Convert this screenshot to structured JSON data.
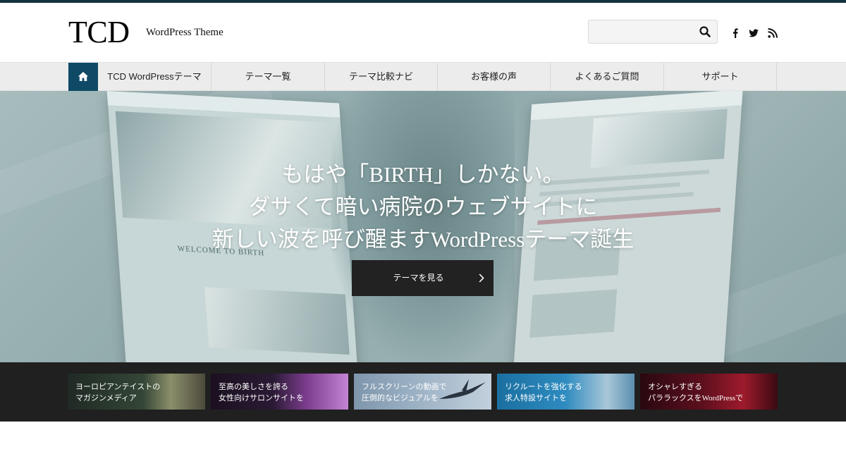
{
  "header": {
    "logo": "TCD",
    "tagline": "WordPress Theme",
    "search": {
      "value": "",
      "placeholder": ""
    },
    "social": [
      "facebook-icon",
      "twitter-icon",
      "rss-icon"
    ]
  },
  "nav": {
    "home_icon": "home-icon",
    "items": [
      {
        "label": "TCD WordPressテーマ"
      },
      {
        "label": "テーマ一覧"
      },
      {
        "label": "テーマ比較ナビ"
      },
      {
        "label": "お客様の声"
      },
      {
        "label": "よくあるご質問"
      },
      {
        "label": "サポート"
      }
    ]
  },
  "hero": {
    "lines": [
      "もはや「BIRTH」しかない。",
      "ダサくて暗い病院のウェブサイトに",
      "新しい波を呼び醒ますWordPressテーマ誕生"
    ],
    "mockup_title": "WELCOME TO BIRTH",
    "button_label": "テーマを見る"
  },
  "banners": [
    {
      "line1": "ヨーロピアンテイストの",
      "line2": "マガジンメディア"
    },
    {
      "line1": "至高の美しさを誇る",
      "line2": "女性向けサロンサイトを"
    },
    {
      "line1": "フルスクリーンの動画で",
      "line2": "圧倒的なビジュアルを"
    },
    {
      "line1": "リクルートを強化する",
      "line2": "求人特設サイトを"
    },
    {
      "line1": "オシャレすぎる",
      "line2": "パララックスをWordPressで"
    }
  ],
  "colors": {
    "top_rule": "#12333f",
    "nav_home": "#0e4a66",
    "nav_bg": "#ececec",
    "hero_button": "#222222",
    "banner_strip": "#202020"
  }
}
